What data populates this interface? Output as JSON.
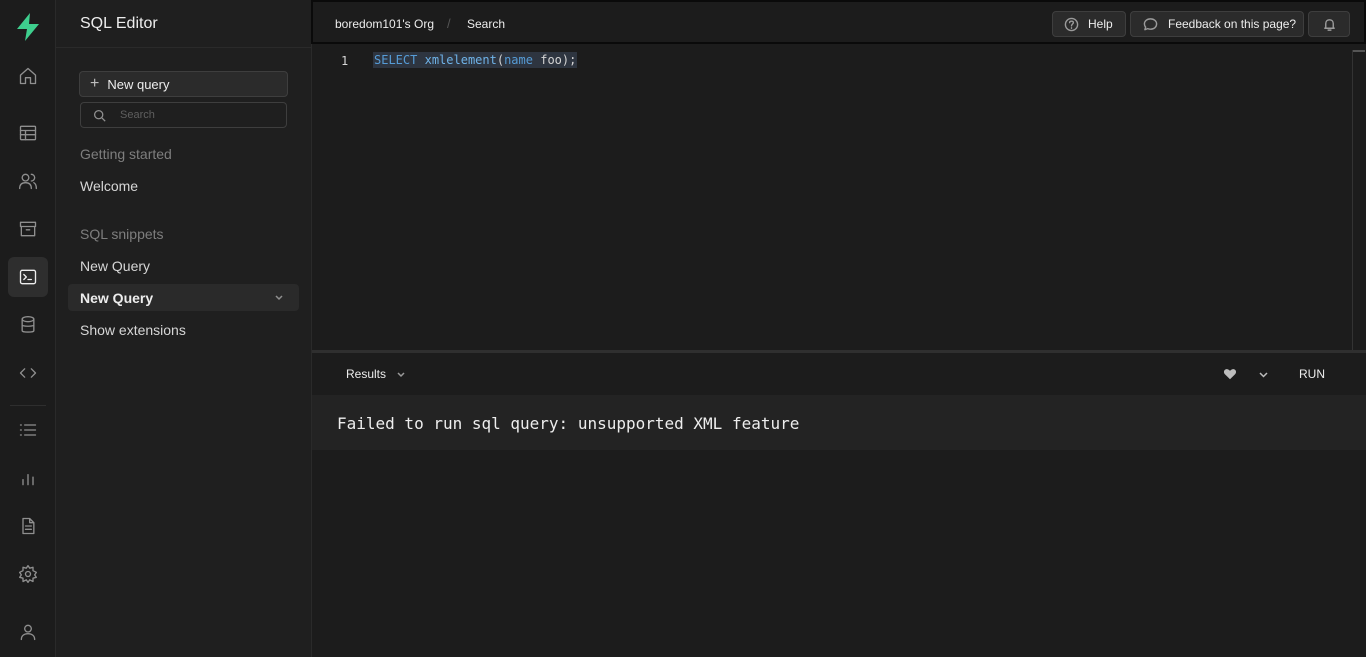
{
  "sidebar": {
    "title": "SQL Editor",
    "new_query_label": "New query",
    "search_placeholder": "Search",
    "sections": {
      "getting_started": "Getting started",
      "welcome": "Welcome",
      "sql_snippets": "SQL snippets",
      "new_query_1": "New Query",
      "new_query_active": "New Query",
      "show_extensions": "Show extensions"
    }
  },
  "topbar": {
    "org": "boredom101's Org",
    "separator": "/",
    "page": "Search",
    "help_label": "Help",
    "feedback_label": "Feedback on this page?"
  },
  "editor": {
    "line_number": "1",
    "code_tokens": {
      "select": "SELECT",
      "space1": " ",
      "func": "xmlelement",
      "paren_open": "(",
      "name": "name",
      "space2": " ",
      "arg": "foo",
      "end": ");"
    }
  },
  "results": {
    "tab_label": "Results",
    "run_label": "RUN",
    "error_message": "Failed to run sql query: unsupported XML feature"
  },
  "colors": {
    "brand": "#3ecf8e",
    "background": "#1c1c1c",
    "keyword": "#569cd6"
  },
  "icons": {
    "rail": [
      "home-icon",
      "table-editor-icon",
      "users-icon",
      "storage-icon",
      "sql-editor-icon",
      "database-icon",
      "code-icon",
      "list-icon",
      "reports-icon",
      "document-icon",
      "settings-icon",
      "user-icon"
    ]
  }
}
